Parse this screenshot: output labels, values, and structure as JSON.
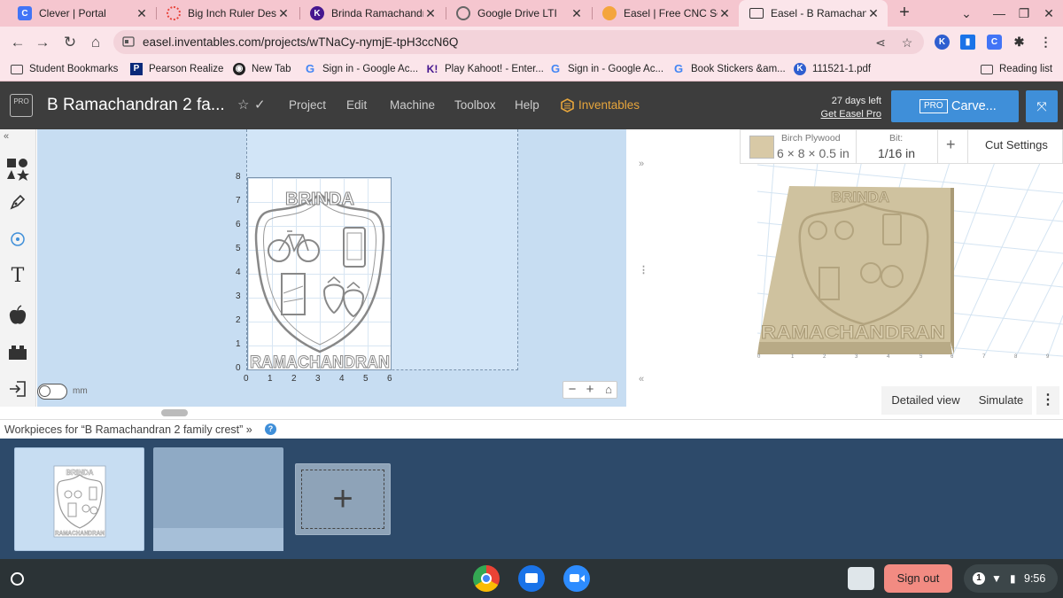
{
  "browser": {
    "tabs": [
      {
        "title": "Clever | Portal",
        "favicon_color": "#4274f6",
        "favicon_glyph": "C",
        "active": false
      },
      {
        "title": "Big Inch Ruler Design",
        "favicon_color": "#e8453c",
        "favicon_glyph": "",
        "active": false
      },
      {
        "title": "Brinda Ramachandran",
        "favicon_color": "#46178f",
        "favicon_glyph": "K",
        "active": false
      },
      {
        "title": "Google Drive LTI",
        "favicon_color": "#666666",
        "favicon_glyph": "",
        "active": false
      },
      {
        "title": "Easel | Free CNC Soft",
        "favicon_color": "#f4a53c",
        "favicon_glyph": "",
        "active": false
      },
      {
        "title": "Easel - B Ramachand",
        "favicon_color": "#333333",
        "favicon_glyph": "",
        "active": true
      }
    ],
    "url": "easel.inventables.com/projects/wTNaCy-nymjE-tpH3ccN6Q",
    "bookmarks": [
      {
        "label": "Student Bookmarks",
        "icon": "folder-icon"
      },
      {
        "label": "Pearson Realize",
        "icon": "pearson-icon"
      },
      {
        "label": "New Tab",
        "icon": "globe-icon"
      },
      {
        "label": "Sign in - Google Ac...",
        "icon": "google-icon"
      },
      {
        "label": "Play Kahoot! - Enter...",
        "icon": "kahoot-icon"
      },
      {
        "label": "Sign in - Google Ac...",
        "icon": "google-icon"
      },
      {
        "label": "Book Stickers &am...",
        "icon": "google-icon"
      },
      {
        "label": "111521-1.pdf",
        "icon": "k-icon"
      }
    ],
    "reading_list": "Reading list"
  },
  "easel": {
    "logo_text": "PRO",
    "project_title": "B Ramachandran 2 fa...",
    "menus": [
      "Project",
      "Edit",
      "Machine",
      "Toolbox",
      "Help"
    ],
    "inventables_label": "Inventables",
    "trial_days": "27 days left",
    "get_pro": "Get Easel Pro",
    "carve_badge": "PRO",
    "carve_label": "Carve...",
    "accent_color": "#3f8fd9"
  },
  "canvas": {
    "y_ticks": [
      "8",
      "7",
      "6",
      "5",
      "4",
      "3",
      "2",
      "1",
      "0"
    ],
    "x_ticks": [
      "0",
      "1",
      "2",
      "3",
      "4",
      "5",
      "6"
    ],
    "design_top_text": "BRINDA",
    "design_bottom_text": "RAMACHANDRAN",
    "unit_label": "mm",
    "zoom_minus": "−",
    "zoom_plus": "+",
    "home_icon": "⌂"
  },
  "material": {
    "name": "Birch Plywood",
    "size": "6 × 8 × 0.5 in",
    "bit_label": "Bit:",
    "bit_value": "1/16 in",
    "add": "+",
    "cut_settings": "Cut Settings",
    "swatch_color": "#d8c9a6"
  },
  "preview": {
    "top_text": "BRINDA",
    "bottom_text": "RAMACHANDRAN",
    "detailed_view": "Detailed view",
    "simulate": "Simulate"
  },
  "workpieces": {
    "title": "Workpieces for “B Ramachandran 2 family crest”",
    "chevron": "»",
    "help": "?",
    "add_symbol": "+"
  },
  "shelf": {
    "sign_out": "Sign out",
    "notifications": "1",
    "time": "9:56"
  }
}
